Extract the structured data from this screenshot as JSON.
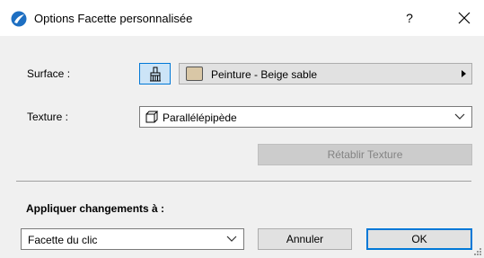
{
  "window": {
    "title": "Options Facette personnalisée",
    "help_label": "?"
  },
  "surface": {
    "label": "Surface :",
    "value": "Peinture - Beige sable",
    "swatch_color": "#d9c7a6"
  },
  "texture": {
    "label": "Texture :",
    "value": "Parallélépipède",
    "reset_label": "Rétablir Texture"
  },
  "apply": {
    "label": "Appliquer changements à :",
    "value": "Facette du clic"
  },
  "buttons": {
    "cancel": "Annuler",
    "ok": "OK"
  },
  "colors": {
    "accent": "#0078d7",
    "app_icon": "#1e6fc2"
  }
}
